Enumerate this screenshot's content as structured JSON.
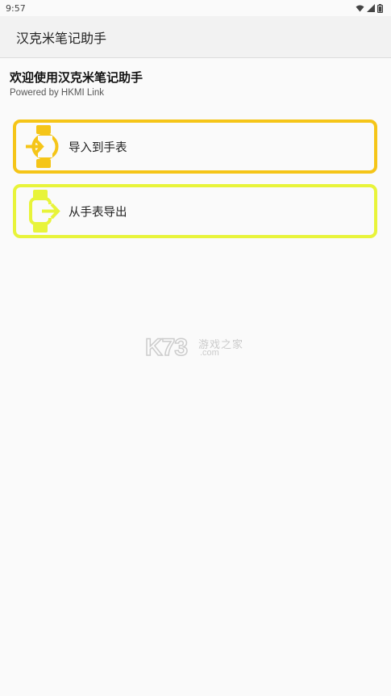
{
  "status_bar": {
    "time": "9:57"
  },
  "app_bar": {
    "title": "汉克米笔记助手"
  },
  "header": {
    "welcome": "欢迎使用汉克米笔记助手",
    "powered_by": "Powered by HKMI Link"
  },
  "actions": [
    {
      "label": "导入到手表",
      "icon": "watch-import-icon",
      "color": "#f5c518"
    },
    {
      "label": "从手表导出",
      "icon": "watch-export-icon",
      "color": "#e8f43a"
    }
  ],
  "watermark": {
    "brand": "K73",
    "cn": "游戏之家",
    "domain": ".com"
  }
}
